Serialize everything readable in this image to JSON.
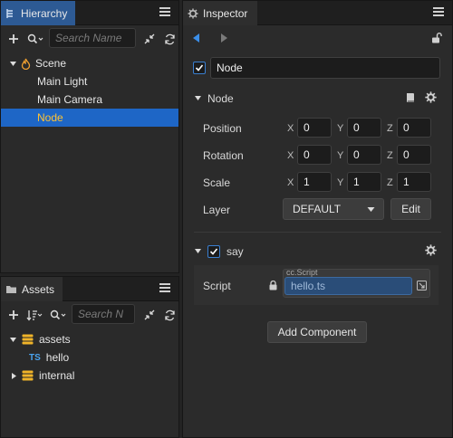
{
  "hierarchy": {
    "tab_label": "Hierarchy",
    "search_placeholder": "Search Name",
    "tree": {
      "scene": "Scene",
      "children": [
        "Main Light",
        "Main Camera",
        "Node"
      ]
    }
  },
  "assets": {
    "tab_label": "Assets",
    "search_placeholder": "Search N",
    "tree": {
      "assets_folder": "assets",
      "hello_file": "hello",
      "hello_prefix": "TS",
      "internal_folder": "internal"
    }
  },
  "inspector": {
    "tab_label": "Inspector",
    "node_name": "Node",
    "node_section_title": "Node",
    "position": {
      "label": "Position",
      "x": "0",
      "y": "0",
      "z": "0"
    },
    "rotation": {
      "label": "Rotation",
      "x": "0",
      "y": "0",
      "z": "0"
    },
    "scale": {
      "label": "Scale",
      "x": "1",
      "y": "1",
      "z": "1"
    },
    "axis_labels": {
      "x": "X",
      "y": "Y",
      "z": "Z"
    },
    "layer": {
      "label": "Layer",
      "value": "DEFAULT",
      "edit_label": "Edit"
    },
    "component": {
      "title": "say",
      "script_label": "Script",
      "script_type": "cc.Script",
      "script_value": "hello.ts"
    },
    "add_component_label": "Add Component"
  },
  "colors": {
    "accent": "#2d5a94",
    "selected_row": "#1e66c6",
    "selected_text": "#ffc233",
    "checkbox": "#3a7fd0"
  }
}
